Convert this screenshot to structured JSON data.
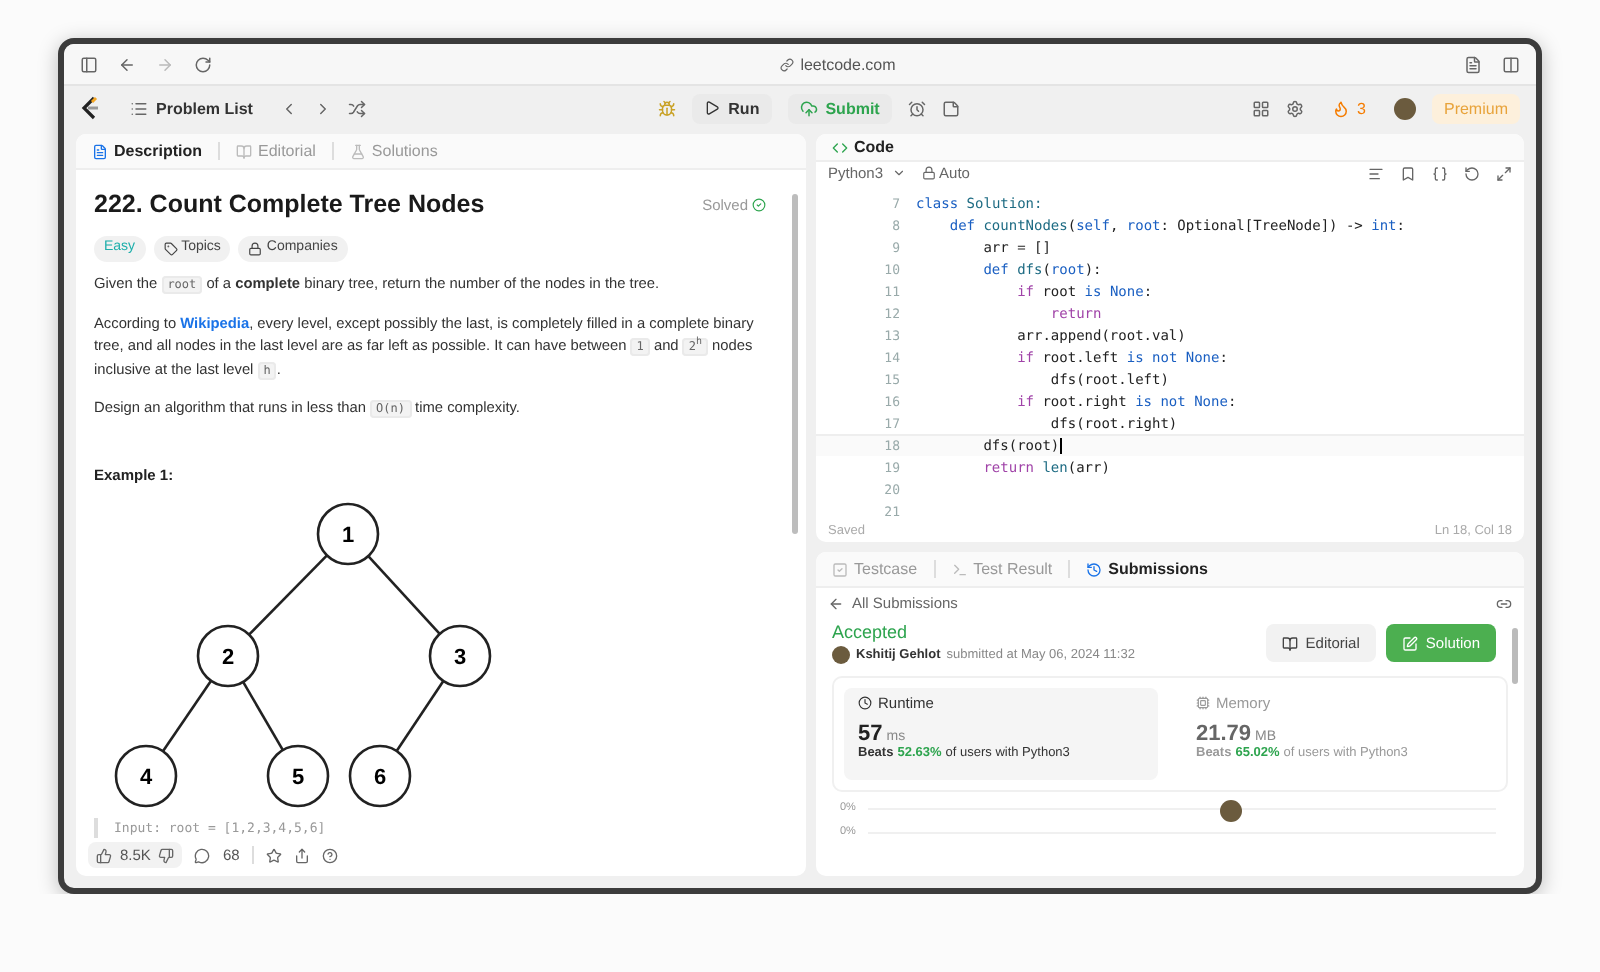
{
  "browser": {
    "url": "leetcode.com"
  },
  "nav": {
    "problem_list": "Problem List",
    "run": "Run",
    "submit": "Submit",
    "streak": "3",
    "premium": "Premium"
  },
  "description_tabs": [
    {
      "label": "Description",
      "selected": true
    },
    {
      "label": "Editorial",
      "selected": false
    },
    {
      "label": "Solutions",
      "selected": false
    }
  ],
  "problem": {
    "title": "222. Count Complete Tree Nodes",
    "status": "Solved",
    "solved": true,
    "tags": [
      {
        "label": "Easy",
        "kind": "difficulty"
      },
      {
        "label": "Topics",
        "kind": "topics"
      },
      {
        "label": "Companies",
        "kind": "companies"
      }
    ],
    "paragraphs": [
      [
        {
          "text": "Given the ",
          "kind": "text"
        },
        {
          "text": "root",
          "kind": "code"
        },
        {
          "text": " of a **complete** binary tree, return the number of the nodes in the tree.",
          "kind": "text"
        }
      ],
      [
        {
          "text": "According to ",
          "kind": "text"
        },
        {
          "text": "Wikipedia",
          "kind": "link"
        },
        {
          "text": ", every level, except possibly the last, is completely filled in a complete binary tree, and all nodes in the last level are as far left as possible. It can have between ",
          "kind": "text"
        },
        {
          "text": "1",
          "kind": "code"
        },
        {
          "text": " and ",
          "kind": "text"
        },
        {
          "text": "2$^{h}$",
          "kind": "code"
        },
        {
          "text": " nodes inclusive at the last level ",
          "kind": "text"
        },
        {
          "text": "h",
          "kind": "code"
        },
        {
          "text": ".",
          "kind": "text"
        }
      ],
      [
        {
          "text": "Design an algorithm that runs in less than ",
          "kind": "text"
        },
        {
          "text": "O(n)",
          "kind": "code"
        },
        {
          "text": " time complexity.",
          "kind": "text"
        }
      ]
    ],
    "example_title": "Example 1:",
    "tree": {
      "label": "1",
      "children": [
        {
          "label": "2",
          "children": [
            {
              "label": "4"
            },
            {
              "label": "5"
            }
          ]
        },
        {
          "label": "3",
          "children": [
            {
              "label": "6"
            }
          ]
        }
      ]
    },
    "input_line": "Input: root = [1,2,3,4,5,6]",
    "likes": "8.5K",
    "comments": "68"
  },
  "code_panel": {
    "title": "Code",
    "language": "Python3",
    "mode": "Auto",
    "lines": [
      {
        "n": "7",
        "active": false,
        "tokens": [
          {
            "text": "class ",
            "kind": "kw"
          },
          {
            "text": "Solution:",
            "kind": "type"
          }
        ]
      },
      {
        "n": "8",
        "active": false,
        "tokens": [
          {
            "text": "    def ",
            "kind": "kw"
          },
          {
            "text": "countNodes",
            "kind": "type"
          },
          {
            "text": "(",
            "kind": "plain"
          },
          {
            "text": "self",
            "kind": "kw"
          },
          {
            "text": ", ",
            "kind": "plain"
          },
          {
            "text": "root",
            "kind": "kw"
          },
          {
            "text": ": Optional[TreeNode]) -> ",
            "kind": "plain"
          },
          {
            "text": "int",
            "kind": "kw"
          },
          {
            "text": ":",
            "kind": "plain"
          }
        ]
      },
      {
        "n": "9",
        "active": false,
        "tokens": [
          {
            "text": "        arr = []",
            "kind": "plain"
          }
        ]
      },
      {
        "n": "10",
        "active": false,
        "tokens": [
          {
            "text": "        def ",
            "kind": "kw"
          },
          {
            "text": "dfs",
            "kind": "type"
          },
          {
            "text": "(",
            "kind": "plain"
          },
          {
            "text": "root",
            "kind": "kw"
          },
          {
            "text": "):",
            "kind": "plain"
          }
        ]
      },
      {
        "n": "11",
        "active": false,
        "tokens": [
          {
            "text": "            if ",
            "kind": "ctl"
          },
          {
            "text": "root ",
            "kind": "plain"
          },
          {
            "text": "is None",
            "kind": "kw"
          },
          {
            "text": ":",
            "kind": "plain"
          }
        ]
      },
      {
        "n": "12",
        "active": false,
        "tokens": [
          {
            "text": "                return",
            "kind": "ctl"
          }
        ]
      },
      {
        "n": "13",
        "active": false,
        "tokens": [
          {
            "text": "            arr.append(root.val)",
            "kind": "plain"
          }
        ]
      },
      {
        "n": "14",
        "active": false,
        "tokens": [
          {
            "text": "            if ",
            "kind": "ctl"
          },
          {
            "text": "root.left ",
            "kind": "plain"
          },
          {
            "text": "is not None",
            "kind": "kw"
          },
          {
            "text": ":",
            "kind": "plain"
          }
        ]
      },
      {
        "n": "15",
        "active": false,
        "tokens": [
          {
            "text": "                dfs(root.left)",
            "kind": "plain"
          }
        ]
      },
      {
        "n": "16",
        "active": false,
        "tokens": [
          {
            "text": "            if ",
            "kind": "ctl"
          },
          {
            "text": "root.right ",
            "kind": "plain"
          },
          {
            "text": "is not None",
            "kind": "kw"
          },
          {
            "text": ":",
            "kind": "plain"
          }
        ]
      },
      {
        "n": "17",
        "active": false,
        "tokens": [
          {
            "text": "                dfs(root.right)",
            "kind": "plain"
          }
        ]
      },
      {
        "n": "18",
        "active": true,
        "tokens": [
          {
            "text": "        dfs(root)",
            "kind": "plain"
          }
        ]
      },
      {
        "n": "19",
        "active": false,
        "tokens": [
          {
            "text": "        return ",
            "kind": "ctl"
          },
          {
            "text": "len",
            "kind": "type"
          },
          {
            "text": "(arr)",
            "kind": "plain"
          }
        ]
      },
      {
        "n": "20",
        "active": false
      },
      {
        "n": "21",
        "active": false
      }
    ],
    "saved": "Saved",
    "cursor": "Ln 18, Col 18"
  },
  "result_tabs": [
    {
      "label": "Testcase",
      "selected": false
    },
    {
      "label": "Test Result",
      "selected": false
    },
    {
      "label": "Submissions",
      "selected": true
    }
  ],
  "submission": {
    "back": "All Submissions",
    "status": "Accepted",
    "user": "Kshitij Gehlot",
    "submitted": "submitted at May 06, 2024 11:32",
    "editorial": "Editorial",
    "solution": "Solution",
    "stats": [
      {
        "title": "Runtime",
        "value": "57",
        "unit": "ms",
        "beats_label": "Beats",
        "percent": "52.63%",
        "suffix": "of users with Python3",
        "selected": true,
        "kind": "time"
      },
      {
        "title": "Memory",
        "value": "21.79",
        "unit": "MB",
        "beats_label": "Beats",
        "percent": "65.02%",
        "suffix": "of users with Python3",
        "selected": false,
        "kind": "memory"
      }
    ],
    "axis_labels": [
      "0%",
      "0%"
    ]
  }
}
